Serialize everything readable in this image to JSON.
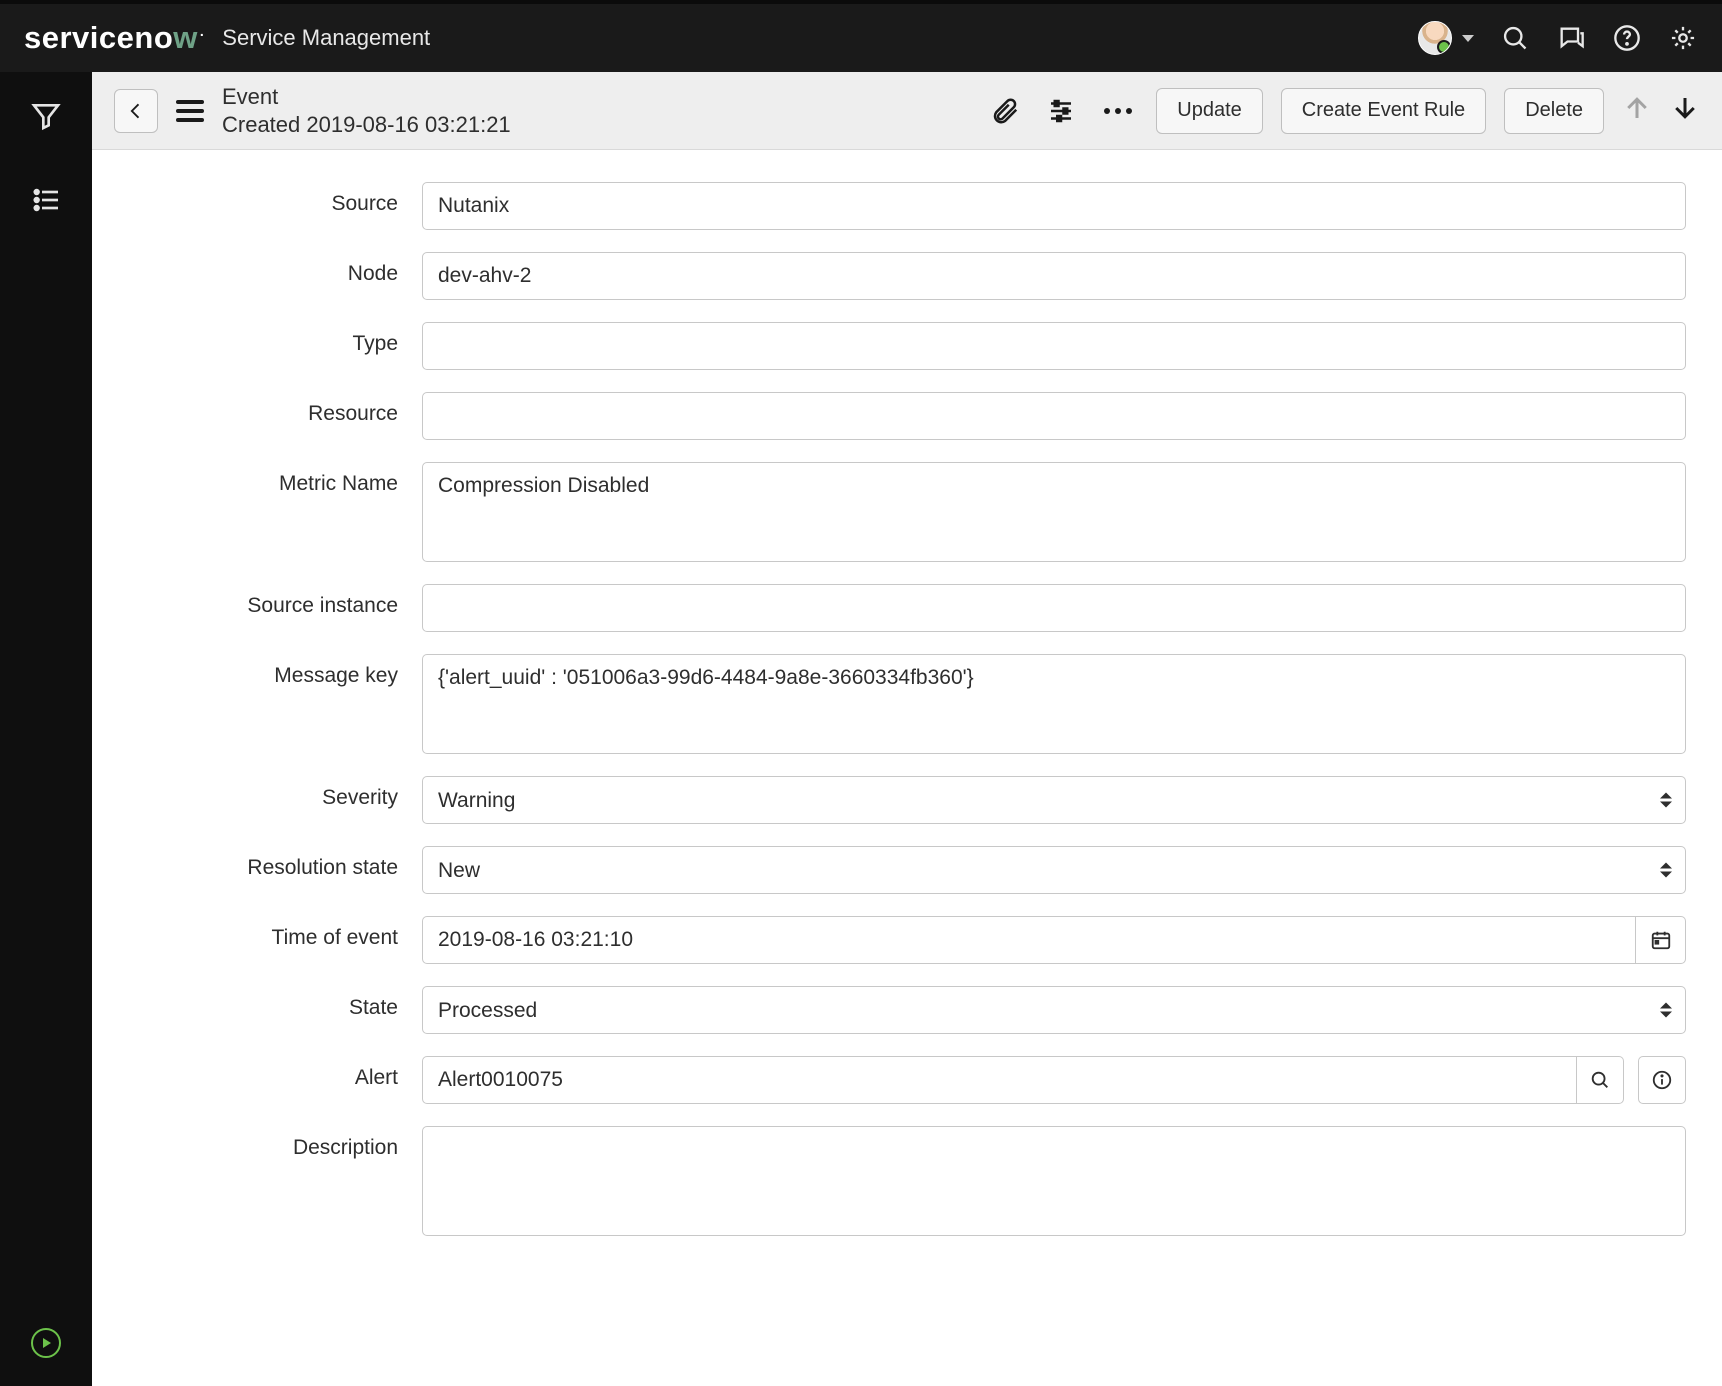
{
  "banner": {
    "logo_pre": "serviceno",
    "logo_accent": "w",
    "app_title": "Service Management"
  },
  "header": {
    "record_type": "Event",
    "record_sub": "Created 2019-08-16 03:21:21",
    "buttons": {
      "update": "Update",
      "create_event_rule": "Create Event Rule",
      "delete": "Delete"
    }
  },
  "form": {
    "labels": {
      "source": "Source",
      "node": "Node",
      "type": "Type",
      "resource": "Resource",
      "metric_name": "Metric Name",
      "source_instance": "Source instance",
      "message_key": "Message key",
      "severity": "Severity",
      "resolution_state": "Resolution state",
      "time_of_event": "Time of event",
      "state": "State",
      "alert": "Alert",
      "description": "Description"
    },
    "values": {
      "source": "Nutanix",
      "node": "dev-ahv-2",
      "type": "",
      "resource": "",
      "metric_name": "Compression Disabled",
      "source_instance": "",
      "message_key": "{'alert_uuid' : '051006a3-99d6-4484-9a8e-3660334fb360'}",
      "severity": "Warning",
      "resolution_state": "New",
      "time_of_event": "2019-08-16 03:21:10",
      "state": "Processed",
      "alert": "Alert0010075",
      "description": ""
    }
  }
}
